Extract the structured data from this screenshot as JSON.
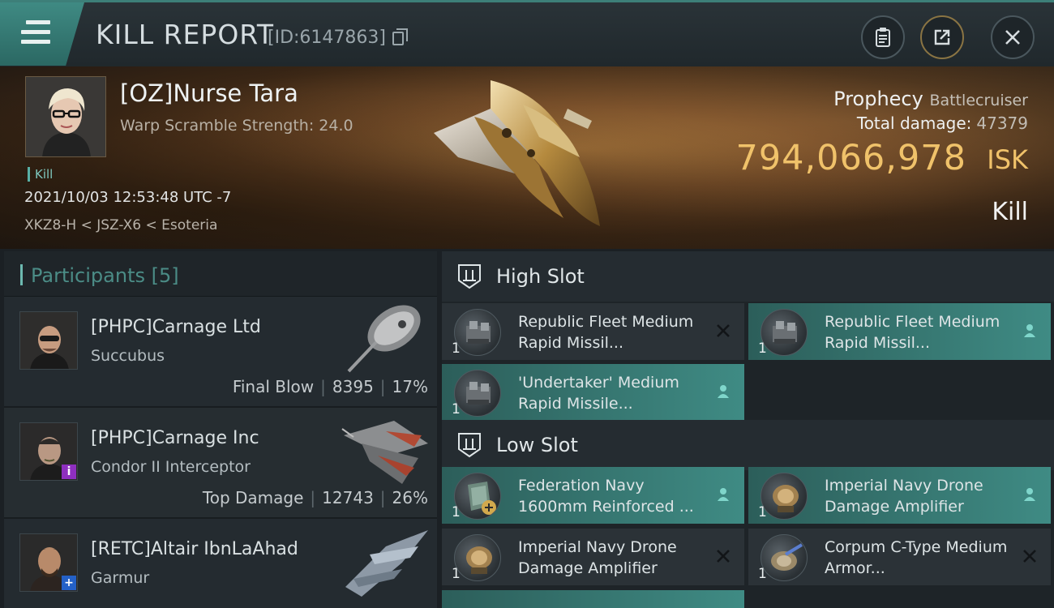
{
  "header": {
    "title": "KILL REPORT",
    "report_id": "[ID:6147863]"
  },
  "victim": {
    "name": "[OZ]Nurse Tara",
    "warp_info": "Warp Scramble Strength: 24.0",
    "tag": "Kill",
    "date": "2021/10/03 12:53:48 UTC -7",
    "location": "XKZ8-H < JSZ-X6 < Esoteria",
    "ship_name": "Prophecy",
    "ship_class": "Battlecruiser",
    "total_damage_label": "Total damage:",
    "total_damage": "47379",
    "isk_value": "794,066,978",
    "isk_unit": "ISK",
    "kill_type": "Kill"
  },
  "participants": {
    "label": "Participants",
    "count": "[5]",
    "items": [
      {
        "name": "[PHPC]Carnage Ltd",
        "ship": "Succubus",
        "role": "Final Blow",
        "damage": "8395",
        "percent": "17%"
      },
      {
        "name": "[PHPC]Carnage Inc",
        "ship": "Condor II Interceptor",
        "role": "Top Damage",
        "damage": "12743",
        "percent": "26%"
      },
      {
        "name": "[RETC]Altair IbnLaAhad",
        "ship": "Garmur"
      }
    ]
  },
  "slots": {
    "high": {
      "label": "High Slot",
      "modules": [
        {
          "name": "Republic Fleet Medium Rapid Missil...",
          "qty": "1",
          "status": "destroyed-icon"
        },
        {
          "name": "Republic Fleet Medium Rapid Missil...",
          "qty": "1",
          "status": "dropped-icon"
        },
        {
          "name": "'Undertaker' Medium Rapid Missile...",
          "qty": "1",
          "status": "dropped-icon"
        }
      ]
    },
    "low": {
      "label": "Low Slot",
      "modules": [
        {
          "name": "Federation Navy 1600mm Reinforced ...",
          "qty": "1",
          "status": "dropped-icon"
        },
        {
          "name": "Imperial Navy Drone Damage Amplifier",
          "qty": "1",
          "status": "dropped-icon"
        },
        {
          "name": "Imperial Navy Drone Damage Amplifier",
          "qty": "1",
          "status": "destroyed-icon"
        },
        {
          "name": "Corpum C-Type Medium Armor...",
          "qty": "1",
          "status": "destroyed-icon"
        }
      ]
    }
  }
}
